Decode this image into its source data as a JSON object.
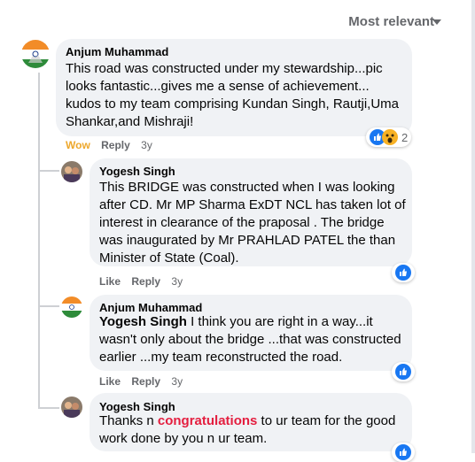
{
  "sort": {
    "label": "Most relevant"
  },
  "comments": [
    {
      "author": "Anjum Muhammad",
      "text": "This road was constructed under my stewardship...pic looks fantastic...gives me a sense of achievement... kudos to my team comprising Kundan Singh, Rautji,Uma Shankar,and Mishraji!",
      "actions": {
        "reaction": "Wow",
        "reply": "Reply",
        "time": "3y"
      },
      "reactions": {
        "count": "2",
        "icons": [
          "like-icon",
          "wow-icon"
        ]
      }
    },
    {
      "author": "Yogesh Singh",
      "text": "This BRIDGE was constructed when I was looking after CD. Mr MP Sharma ExDT NCL has taken lot of interest in clearance of the praposal . The bridge was inaugurated by Mr PRAHLAD PATEL the than Minister of State (Coal).",
      "actions": {
        "like": "Like",
        "reply": "Reply",
        "time": "3y"
      },
      "reactions": {
        "icons": [
          "like-icon"
        ]
      }
    },
    {
      "author": "Anjum Muhammad",
      "mention": "Yogesh Singh",
      "text": " I think you are right in a way...it wasn't only about the bridge ...that was constructed earlier ...my team reconstructed the road.",
      "actions": {
        "like": "Like",
        "reply": "Reply",
        "time": "3y"
      },
      "reactions": {
        "icons": [
          "like-icon"
        ]
      }
    },
    {
      "author": "Yogesh Singh",
      "text_before": "Thanks n ",
      "highlight": "congratulations",
      "text_after": " to ur team for the good work done by you n ur team.",
      "reactions": {
        "icons": [
          "like-icon"
        ]
      }
    }
  ],
  "colors": {
    "accent": "#1877f2",
    "wow": "#eda72b",
    "highlight": "#e41e3f",
    "bubble": "#f0f2f5"
  }
}
